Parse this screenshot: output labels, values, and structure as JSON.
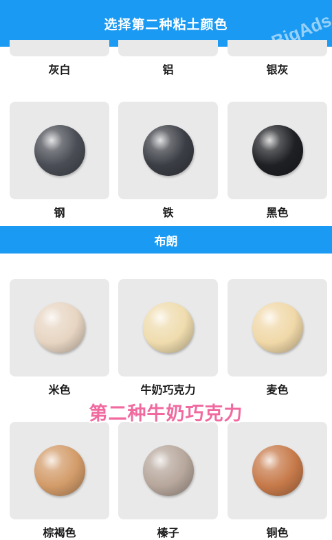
{
  "header": {
    "title": "选择第二种粘土颜色",
    "watermark": "BigBigAds"
  },
  "rows": [
    {
      "labels": [
        "灰白",
        "铝",
        "银灰"
      ]
    },
    {
      "labels": [
        "钢",
        "铁",
        "黑色"
      ],
      "colors": [
        "#4a4d55",
        "#3b3e45",
        "#1f2024"
      ]
    }
  ],
  "section": {
    "title": "布朗"
  },
  "brown_rows": [
    {
      "labels": [
        "米色",
        "牛奶巧克力",
        "麦色"
      ],
      "colors": [
        "#e7d5c2",
        "#efdcae",
        "#f0d8a8"
      ]
    },
    {
      "labels": [
        "棕褐色",
        "榛子",
        "铜色"
      ],
      "colors": [
        "#d39c6a",
        "#b7a79c",
        "#c77a4a"
      ]
    }
  ],
  "caption": "第二种牛奶巧克力"
}
